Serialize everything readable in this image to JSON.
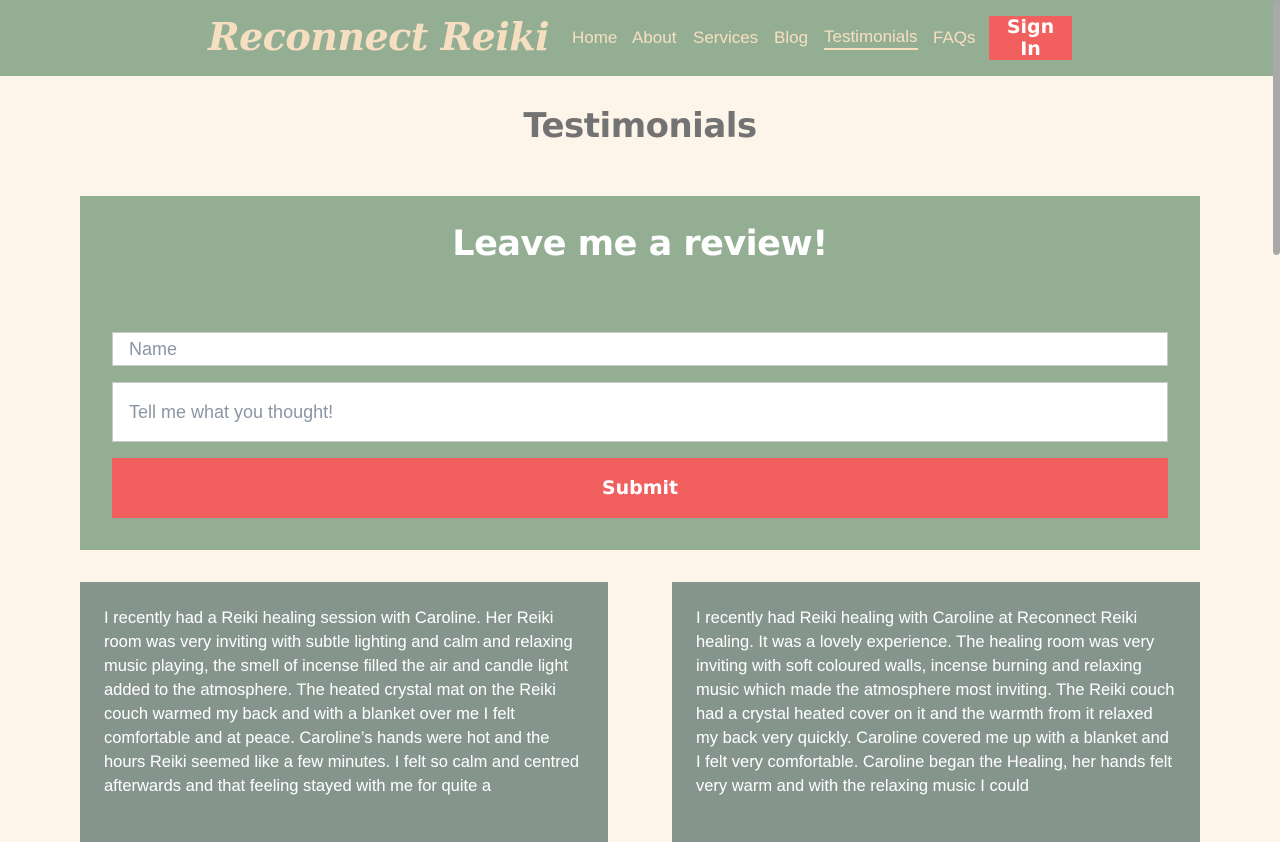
{
  "brand": "Reconnect Reiki",
  "nav": {
    "items": [
      "Home",
      "About",
      "Services",
      "Blog",
      "Testimonials",
      "FAQs"
    ],
    "active": "Testimonials",
    "signin_label": "Sign In"
  },
  "page_title": "Testimonials",
  "review_form": {
    "heading": "Leave me a review!",
    "name_placeholder": "Name",
    "message_placeholder": "Tell me what you thought!",
    "submit_label": "Submit"
  },
  "testimonials": [
    {
      "text": "I recently had a Reiki healing session with Caroline. Her Reiki room was very inviting with subtle lighting and calm and relaxing music playing, the smell of incense filled the air and candle light added to the atmosphere. The heated crystal mat on the Reiki couch warmed my back and with a blanket over me I felt comfortable and at peace. Caroline’s hands were hot and the hours Reiki seemed like a few minutes. I felt so calm and centred afterwards and that feeling stayed with me for quite a"
    },
    {
      "text": "I recently had Reiki healing with Caroline at Reconnect Reiki healing. It was a lovely experience. The healing room was very inviting with soft coloured walls, incense burning and relaxing music which made the atmosphere most inviting. The Reiki couch had a crystal heated cover on it and the warmth from it relaxed my back very quickly. Caroline covered me up with a blanket and I felt very comfortable. Caroline began the Healing, her hands felt very warm and with the relaxing music I could"
    }
  ],
  "colors": {
    "nav_bg": "#94ae94",
    "brand_text": "#f6dfc1",
    "accent": "#f1605e",
    "page_bg": "#fdf4ea",
    "card_bg": "#85958d",
    "title_text": "#737373"
  }
}
